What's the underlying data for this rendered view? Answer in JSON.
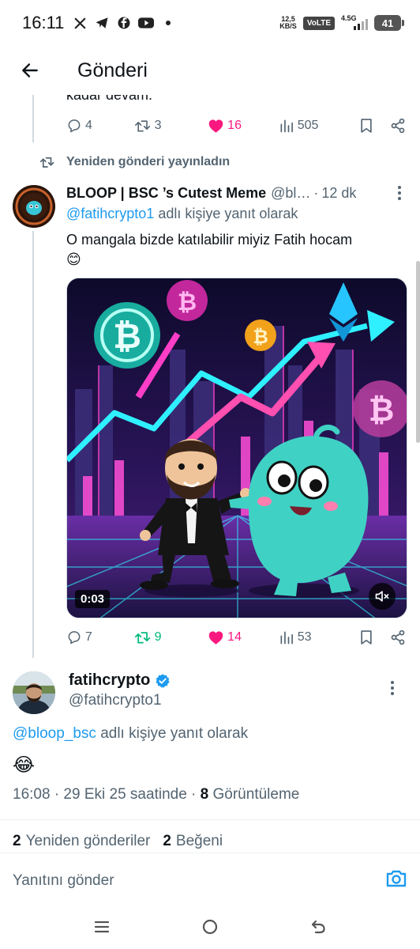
{
  "status_bar": {
    "time": "16:11",
    "net_speed": "12,5",
    "net_speed_unit": "KB/S",
    "volte": "VoLTE",
    "network": "4.5G",
    "battery": "41"
  },
  "header": {
    "title": "Gönderi"
  },
  "prev_post": {
    "clipped_text": "kadar devam.",
    "replies": "4",
    "reposts": "3",
    "likes": "16",
    "views": "505"
  },
  "repost_notice": "Yeniden gönderi yayınladın",
  "reply_post": {
    "author_name": "BLOOP | BSC ’s Cutest Meme",
    "handle": "@bl…",
    "dot": "·",
    "time": "12 dk",
    "reply_to_mention": "@fatihcrypto1",
    "reply_to_suffix": " adlı kişiye yanıt olarak",
    "text": "O mangala bizde katılabilir miyiz Fatih hocam",
    "emoji": "😊",
    "video_duration": "0:03",
    "replies": "7",
    "reposts": "9",
    "likes": "14",
    "views": "53"
  },
  "main_post": {
    "author_name": "fatihcrypto",
    "handle": "@fatihcrypto1",
    "reply_to_mention": "@bloop_bsc",
    "reply_to_suffix": " adlı kişiye yanıt olarak",
    "emoji": "😂",
    "timestamp": "16:08 · 29 Eki 25 saatinde · ",
    "view_count": "8",
    "view_label": " Görüntüleme",
    "reposts_count": "2",
    "reposts_label": "Yeniden gönderiler",
    "likes_count": "2",
    "likes_label": "Beğeni"
  },
  "composer": {
    "placeholder": "Yanıtını gönder"
  },
  "colors": {
    "accent": "#1d9bf0",
    "like": "#f91880",
    "repost": "#00ba7c",
    "secondary_text": "#536471",
    "verified": "#1d9bf0"
  },
  "icons": [
    "x-icon",
    "telegram-icon",
    "facebook-icon",
    "youtube-icon",
    "back-arrow-icon",
    "reply-icon",
    "repost-icon",
    "heart-icon",
    "views-icon",
    "bookmark-icon",
    "share-icon",
    "more-icon",
    "verified-icon",
    "mute-icon",
    "media-icon",
    "recents-icon",
    "home-icon",
    "back-icon"
  ]
}
